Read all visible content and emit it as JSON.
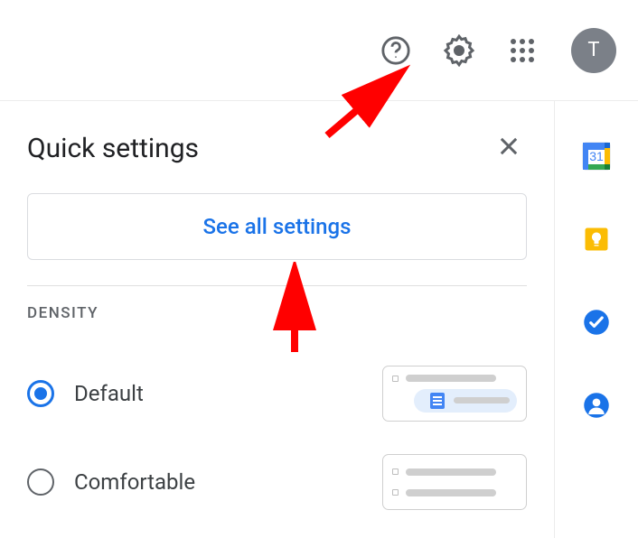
{
  "topbar": {
    "avatar_initial": "T"
  },
  "panel": {
    "title": "Quick settings",
    "see_all_label": "See all settings",
    "density": {
      "section_label": "DENSITY",
      "options": [
        {
          "label": "Default",
          "selected": true
        },
        {
          "label": "Comfortable",
          "selected": false
        }
      ]
    }
  },
  "sidebar": {
    "calendar_day": "31"
  }
}
